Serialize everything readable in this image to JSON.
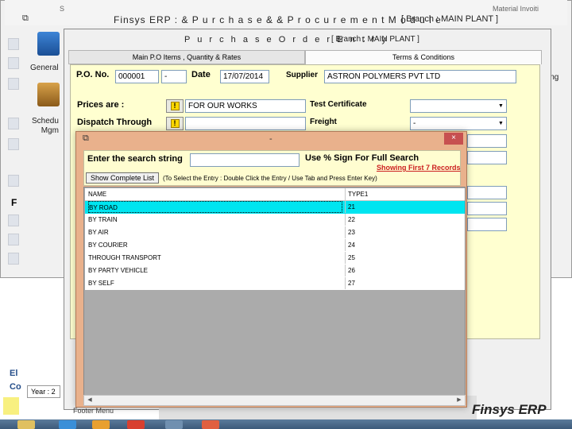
{
  "outer": {
    "title": "Finsys ERP  :  & P u r c h a s e   & &  P r o c u r e m e n t   M o d u l e",
    "branch": "[ Branch : MAIN PLANT ]",
    "top_left_fragment": "S",
    "top_right_fragment": "Material Invoiti",
    "right_fragment": "ing",
    "side_letter": "F",
    "side_bottom_letters": "El\nCo",
    "fy_label": "Year : 2",
    "footer_menu": "Footer Menu",
    "brand": "Finsys ERP",
    "icons": [
      {
        "name": "general-icon",
        "label": "General"
      },
      {
        "name": "schedule-icon",
        "label": "Schedu\nMgm"
      }
    ]
  },
  "po_window": {
    "title": "P u r c h a s e   O r d e r   E n t r y",
    "branch": "[ Branch : MAIN PLANT ]",
    "tabs": [
      {
        "label": "Main P.O Items , Quantity & Rates",
        "active": false
      },
      {
        "label": "Terms & Conditions",
        "active": true
      }
    ],
    "po_no_label": "P.O. No.",
    "po_no_value": "000001",
    "po_dash": "-",
    "date_label": "Date",
    "date_value": "17/07/2014",
    "supplier_label": "Supplier",
    "supplier_value": "ASTRON POLYMERS PVT LTD",
    "prices_label": "Prices are :",
    "prices_value": "FOR OUR WORKS",
    "dispatch_label": "Dispatch Through",
    "dispatch_value": "",
    "test_cert_label": "Test Certificate",
    "test_cert_value": "",
    "freight_label": "Freight",
    "freight_value": "-"
  },
  "search_dialog": {
    "title": "-",
    "close_label": "×",
    "search_label": "Enter the search string",
    "search_value": "",
    "hint": "Use % Sign For Full Search",
    "records_info": "Showing First 7 Records",
    "show_button": "Show Complete List",
    "help_text": "(To Select the Entry : Double Click the Entry / Use Tab and Press Enter Key)",
    "columns": [
      "NAME",
      "TYPE1"
    ],
    "rows": [
      {
        "name": "BY ROAD",
        "type": "21",
        "selected": true
      },
      {
        "name": "BY TRAIN",
        "type": "22",
        "selected": false
      },
      {
        "name": "BY AIR",
        "type": "23",
        "selected": false
      },
      {
        "name": "BY COURIER",
        "type": "24",
        "selected": false
      },
      {
        "name": "THROUGH TRANSPORT",
        "type": "25",
        "selected": false
      },
      {
        "name": "BY PARTY VEHICLE",
        "type": "26",
        "selected": false
      },
      {
        "name": "BY SELF",
        "type": "27",
        "selected": false
      }
    ]
  },
  "colors": {
    "selected_row": "#00e5f0",
    "dialog_frame": "#e9b18c",
    "panel_yellow": "#ffffd0",
    "close_button": "#c75050"
  }
}
